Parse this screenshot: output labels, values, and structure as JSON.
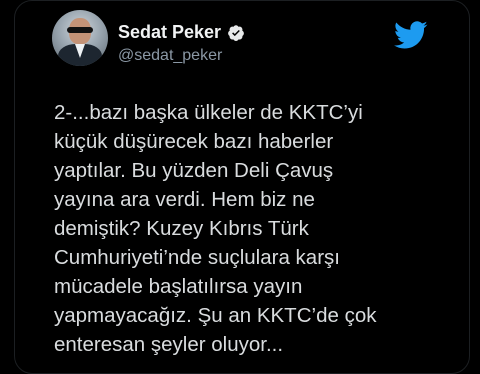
{
  "author": {
    "display_name": "Sedat Peker",
    "handle": "@sedat_peker",
    "verified": true
  },
  "icons": {
    "verified": "verified-badge-icon",
    "brand": "twitter-bird-icon"
  },
  "tweet": {
    "lines": [
      "2-...bazı başka ülkeler de KKTC’yi",
      "küçük düşürecek bazı haberler",
      "yaptılar. Bu yüzden Deli Çavuş",
      "yayına ara verdi. Hem biz ne",
      "demiştik? Kuzey Kıbrıs Türk",
      "Cumhuriyeti’nde suçlulara karşı",
      "mücadele başlatılırsa yayın",
      "yapmayacağız. Şu an KKTC’de çok",
      "enteresan şeyler oluyor..."
    ]
  },
  "colors": {
    "background": "#000000",
    "text": "#d9dcde",
    "handle": "#8b98a5",
    "twitter_blue": "#1d9bf0"
  }
}
